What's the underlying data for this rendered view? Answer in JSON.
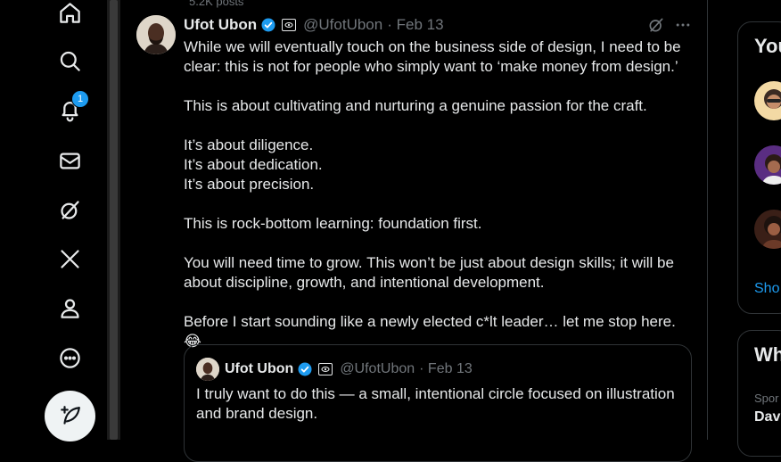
{
  "nav": {
    "notifications_count": "1",
    "items": [
      "home-icon",
      "search-icon",
      "bell-icon",
      "mail-icon",
      "grok-icon",
      "x-logo-icon",
      "person-icon",
      "more-circle-icon"
    ],
    "compose_icon": "feather-plus-icon"
  },
  "timeline": {
    "reposts_hint": "5.2K posts"
  },
  "tweet": {
    "author_name": "Ufot Ubon",
    "handle": "@UfotUbon",
    "date": "· Feb 13",
    "paragraphs": [
      "While we will eventually touch on the business side of design, I need to be clear: this is not for people who simply want to ‘make money from design.’",
      "This is about cultivating and nurturing a genuine passion for the craft.",
      "It’s about diligence.",
      "It’s about dedication.",
      "It’s about precision.",
      "This is rock-bottom learning: foundation first.",
      "You will need time to grow. This won’t be just about design skills; it will be about discipline, growth, and intentional development.",
      "Before I start sounding like a newly elected c*lt leader… let me stop here. 😂"
    ]
  },
  "quote": {
    "author_name": "Ufot Ubon",
    "handle": "@UfotUbon",
    "date": "· Feb 13",
    "text": "I truly want to do this — a small, intentional circle focused on illustration and brand design."
  },
  "sidebar": {
    "who_to_follow_title": "You",
    "show_more": "Sho",
    "whats_happening_title": "Wh",
    "trend_category": "Spor",
    "trend_name": "Dav"
  },
  "colors": {
    "accent": "#1d9bf0",
    "background": "#000000",
    "text": "#e7e9ea",
    "muted": "#71767b",
    "border": "#2f3336"
  }
}
